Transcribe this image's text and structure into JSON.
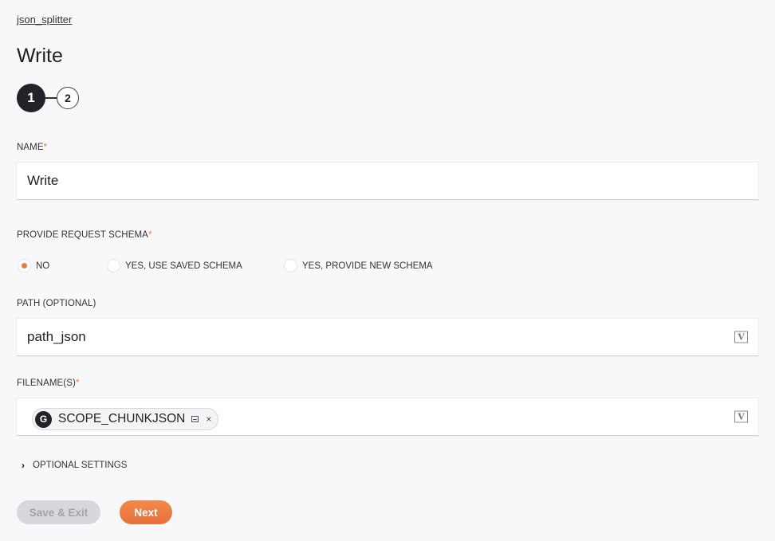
{
  "breadcrumb": {
    "label": "json_splitter"
  },
  "header": {
    "title": "Write"
  },
  "stepper": {
    "steps": [
      {
        "number": "1",
        "state": "active"
      },
      {
        "number": "2",
        "state": "inactive"
      }
    ]
  },
  "form": {
    "name": {
      "label": "NAME",
      "required_mark": "*",
      "value": "Write"
    },
    "schema": {
      "label": "PROVIDE REQUEST SCHEMA",
      "required_mark": "*",
      "options": [
        {
          "label": "NO",
          "selected": true
        },
        {
          "label": "YES, USE SAVED SCHEMA",
          "selected": false
        },
        {
          "label": "YES, PROVIDE NEW SCHEMA",
          "selected": false
        }
      ]
    },
    "path": {
      "label": "PATH (OPTIONAL)",
      "value": "path_json",
      "icon": "variable-icon",
      "icon_glyph": "V"
    },
    "filenames": {
      "label": "FILENAME(S)",
      "required_mark": "*",
      "icon": "variable-icon",
      "icon_glyph": "V",
      "chips": [
        {
          "badge": "G",
          "text": "SCOPE_CHUNKJSON",
          "close_glyph": "×"
        }
      ]
    },
    "optional_settings": {
      "label": "OPTIONAL SETTINGS",
      "chevron_glyph": "›"
    }
  },
  "actions": {
    "save_exit_label": "Save & Exit",
    "next_label": "Next"
  },
  "colors": {
    "accent": "#ef7b3b",
    "step_active": "#232228",
    "button_disabled": "#d8d7dd"
  }
}
